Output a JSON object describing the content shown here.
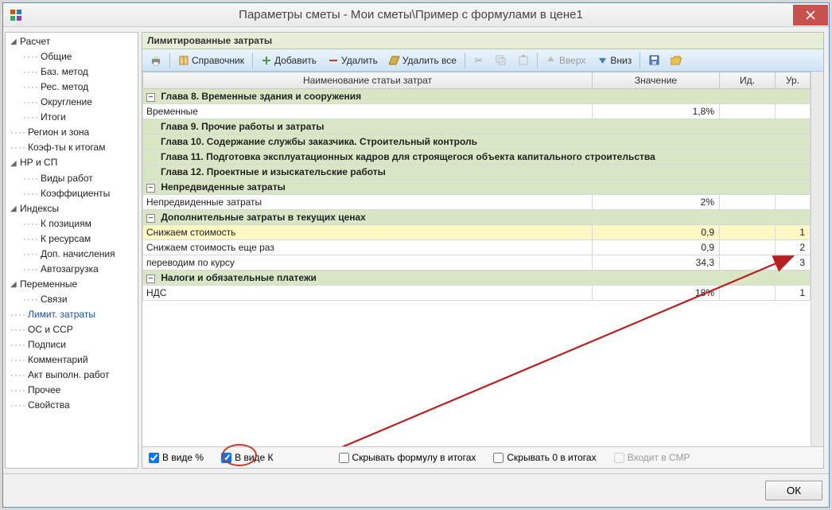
{
  "titlebar": {
    "title": "Параметры сметы - Мои сметы\\Пример с формулами в цене1"
  },
  "tree": {
    "nodes": [
      {
        "label": "Расчет",
        "lvl": 0,
        "exp": "▾"
      },
      {
        "label": "Общие",
        "lvl": 1
      },
      {
        "label": "Баз. метод",
        "lvl": 1
      },
      {
        "label": "Рес. метод",
        "lvl": 1
      },
      {
        "label": "Округление",
        "lvl": 1
      },
      {
        "label": "Итоги",
        "lvl": 1
      },
      {
        "label": "Регион и зона",
        "lvl": 0,
        "dash": true
      },
      {
        "label": "Коэф-ты к итогам",
        "lvl": 0,
        "dash": true
      },
      {
        "label": "НР и СП",
        "lvl": 0,
        "exp": "▾"
      },
      {
        "label": "Виды работ",
        "lvl": 1
      },
      {
        "label": "Коэффициенты",
        "lvl": 1
      },
      {
        "label": "Индексы",
        "lvl": 0,
        "exp": "▾"
      },
      {
        "label": "К позициям",
        "lvl": 1
      },
      {
        "label": "К ресурсам",
        "lvl": 1
      },
      {
        "label": "Доп. начисления",
        "lvl": 1
      },
      {
        "label": "Автозагрузка",
        "lvl": 1
      },
      {
        "label": "Переменные",
        "lvl": 0,
        "exp": "▾"
      },
      {
        "label": "Связи",
        "lvl": 1
      },
      {
        "label": "Лимит. затраты",
        "lvl": 0,
        "dash": true,
        "selected": true
      },
      {
        "label": "ОС и ССР",
        "lvl": 0,
        "dash": true
      },
      {
        "label": "Подписи",
        "lvl": 0,
        "dash": true
      },
      {
        "label": "Комментарий",
        "lvl": 0,
        "dash": true
      },
      {
        "label": "Акт выполн. работ",
        "lvl": 0,
        "dash": true
      },
      {
        "label": "Прочее",
        "lvl": 0,
        "dash": true
      },
      {
        "label": "Свойства",
        "lvl": 0,
        "dash": true
      }
    ]
  },
  "main": {
    "header": "Лимитированные затраты",
    "toolbar": {
      "help": "Справочник",
      "add": "Добавить",
      "del": "Удалить",
      "delall": "Удалить все",
      "up": "Вверх",
      "down": "Вниз"
    },
    "columns": {
      "name": "Наименование статьи затрат",
      "value": "Значение",
      "id": "Ид.",
      "lvl": "Ур."
    },
    "rows": [
      {
        "type": "section",
        "exp": "-",
        "name": "Глава 8. Временные здания и сооружения"
      },
      {
        "type": "data",
        "name": "Временные",
        "value": "1,8%",
        "id": "",
        "lvl": ""
      },
      {
        "type": "chapter",
        "name": "Глава 9. Прочие работы и затраты"
      },
      {
        "type": "chapter",
        "name": "Глава 10. Содержание службы заказчика. Строительный контроль"
      },
      {
        "type": "chapter",
        "name": "Глава 11. Подготовка эксплуатационных кадров для строящегося объекта капитального строительства"
      },
      {
        "type": "chapter",
        "name": "Глава 12. Проектные и изыскательские работы"
      },
      {
        "type": "section",
        "exp": "-",
        "name": "Непредвиденные затраты"
      },
      {
        "type": "data",
        "name": "Непредвиденные затраты",
        "value": "2%",
        "id": "",
        "lvl": ""
      },
      {
        "type": "section",
        "exp": "-",
        "name": "Дополнительные затраты в текущих ценах"
      },
      {
        "type": "highlight",
        "name": "Снижаем стоимость",
        "value": "0,9",
        "id": "",
        "lvl": "1"
      },
      {
        "type": "data",
        "name": "Снижаем стоимость еще раз",
        "value": "0,9",
        "id": "",
        "lvl": "2"
      },
      {
        "type": "data",
        "name": "переводим по курсу",
        "value": "34,3",
        "id": "",
        "lvl": "3"
      },
      {
        "type": "section",
        "exp": "-",
        "name": "Налоги и обязательные платежи"
      },
      {
        "type": "data",
        "name": "НДС",
        "value": "18%",
        "id": "",
        "lvl": "1"
      }
    ],
    "checks": {
      "pct": "В виде %",
      "k": "В виде К",
      "hideFormula": "Скрывать формулу в итогах",
      "hideZero": "Скрывать 0 в итогах",
      "smr": "Входит в СМР"
    }
  },
  "footer": {
    "ok": "ОК"
  }
}
